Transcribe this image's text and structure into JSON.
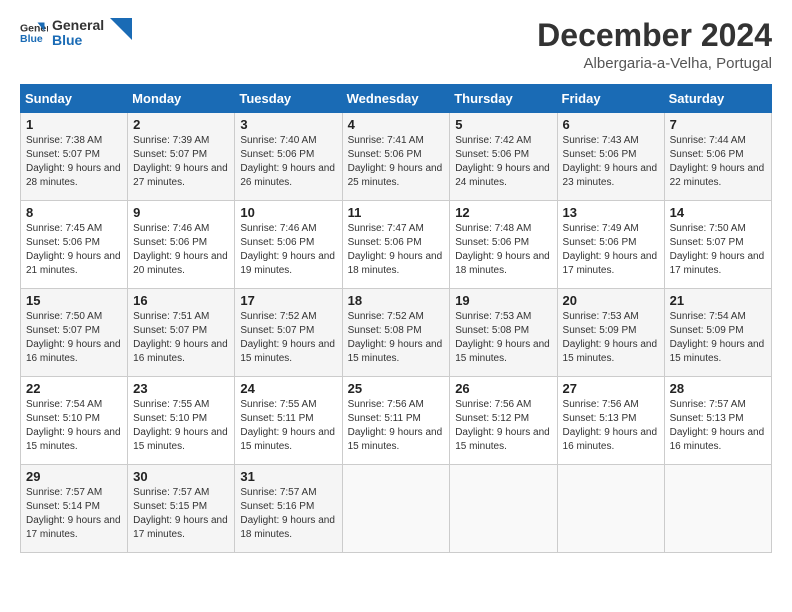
{
  "header": {
    "logo_line1": "General",
    "logo_line2": "Blue",
    "month_title": "December 2024",
    "location": "Albergaria-a-Velha, Portugal"
  },
  "days_of_week": [
    "Sunday",
    "Monday",
    "Tuesday",
    "Wednesday",
    "Thursday",
    "Friday",
    "Saturday"
  ],
  "weeks": [
    [
      {
        "day": "1",
        "sunrise": "7:38 AM",
        "sunset": "5:07 PM",
        "daylight": "9 hours and 28 minutes."
      },
      {
        "day": "2",
        "sunrise": "7:39 AM",
        "sunset": "5:07 PM",
        "daylight": "9 hours and 27 minutes."
      },
      {
        "day": "3",
        "sunrise": "7:40 AM",
        "sunset": "5:06 PM",
        "daylight": "9 hours and 26 minutes."
      },
      {
        "day": "4",
        "sunrise": "7:41 AM",
        "sunset": "5:06 PM",
        "daylight": "9 hours and 25 minutes."
      },
      {
        "day": "5",
        "sunrise": "7:42 AM",
        "sunset": "5:06 PM",
        "daylight": "9 hours and 24 minutes."
      },
      {
        "day": "6",
        "sunrise": "7:43 AM",
        "sunset": "5:06 PM",
        "daylight": "9 hours and 23 minutes."
      },
      {
        "day": "7",
        "sunrise": "7:44 AM",
        "sunset": "5:06 PM",
        "daylight": "9 hours and 22 minutes."
      }
    ],
    [
      {
        "day": "8",
        "sunrise": "7:45 AM",
        "sunset": "5:06 PM",
        "daylight": "9 hours and 21 minutes."
      },
      {
        "day": "9",
        "sunrise": "7:46 AM",
        "sunset": "5:06 PM",
        "daylight": "9 hours and 20 minutes."
      },
      {
        "day": "10",
        "sunrise": "7:46 AM",
        "sunset": "5:06 PM",
        "daylight": "9 hours and 19 minutes."
      },
      {
        "day": "11",
        "sunrise": "7:47 AM",
        "sunset": "5:06 PM",
        "daylight": "9 hours and 18 minutes."
      },
      {
        "day": "12",
        "sunrise": "7:48 AM",
        "sunset": "5:06 PM",
        "daylight": "9 hours and 18 minutes."
      },
      {
        "day": "13",
        "sunrise": "7:49 AM",
        "sunset": "5:06 PM",
        "daylight": "9 hours and 17 minutes."
      },
      {
        "day": "14",
        "sunrise": "7:50 AM",
        "sunset": "5:07 PM",
        "daylight": "9 hours and 17 minutes."
      }
    ],
    [
      {
        "day": "15",
        "sunrise": "7:50 AM",
        "sunset": "5:07 PM",
        "daylight": "9 hours and 16 minutes."
      },
      {
        "day": "16",
        "sunrise": "7:51 AM",
        "sunset": "5:07 PM",
        "daylight": "9 hours and 16 minutes."
      },
      {
        "day": "17",
        "sunrise": "7:52 AM",
        "sunset": "5:07 PM",
        "daylight": "9 hours and 15 minutes."
      },
      {
        "day": "18",
        "sunrise": "7:52 AM",
        "sunset": "5:08 PM",
        "daylight": "9 hours and 15 minutes."
      },
      {
        "day": "19",
        "sunrise": "7:53 AM",
        "sunset": "5:08 PM",
        "daylight": "9 hours and 15 minutes."
      },
      {
        "day": "20",
        "sunrise": "7:53 AM",
        "sunset": "5:09 PM",
        "daylight": "9 hours and 15 minutes."
      },
      {
        "day": "21",
        "sunrise": "7:54 AM",
        "sunset": "5:09 PM",
        "daylight": "9 hours and 15 minutes."
      }
    ],
    [
      {
        "day": "22",
        "sunrise": "7:54 AM",
        "sunset": "5:10 PM",
        "daylight": "9 hours and 15 minutes."
      },
      {
        "day": "23",
        "sunrise": "7:55 AM",
        "sunset": "5:10 PM",
        "daylight": "9 hours and 15 minutes."
      },
      {
        "day": "24",
        "sunrise": "7:55 AM",
        "sunset": "5:11 PM",
        "daylight": "9 hours and 15 minutes."
      },
      {
        "day": "25",
        "sunrise": "7:56 AM",
        "sunset": "5:11 PM",
        "daylight": "9 hours and 15 minutes."
      },
      {
        "day": "26",
        "sunrise": "7:56 AM",
        "sunset": "5:12 PM",
        "daylight": "9 hours and 15 minutes."
      },
      {
        "day": "27",
        "sunrise": "7:56 AM",
        "sunset": "5:13 PM",
        "daylight": "9 hours and 16 minutes."
      },
      {
        "day": "28",
        "sunrise": "7:57 AM",
        "sunset": "5:13 PM",
        "daylight": "9 hours and 16 minutes."
      }
    ],
    [
      {
        "day": "29",
        "sunrise": "7:57 AM",
        "sunset": "5:14 PM",
        "daylight": "9 hours and 17 minutes."
      },
      {
        "day": "30",
        "sunrise": "7:57 AM",
        "sunset": "5:15 PM",
        "daylight": "9 hours and 17 minutes."
      },
      {
        "day": "31",
        "sunrise": "7:57 AM",
        "sunset": "5:16 PM",
        "daylight": "9 hours and 18 minutes."
      },
      null,
      null,
      null,
      null
    ]
  ]
}
